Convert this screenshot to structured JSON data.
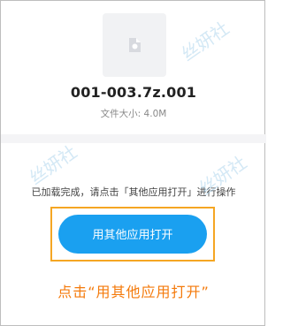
{
  "file": {
    "icon": "file-generic-icon",
    "name": "001-003.7z.001",
    "size_text": "文件大小: 4.0M"
  },
  "status": {
    "text": "已加载完成，请点击「其他应用打开」进行操作"
  },
  "open_button": {
    "label": "用其他应用打开"
  },
  "instruction": {
    "text": "点击“用其他应用打开”"
  },
  "watermark": {
    "text": "丝妍社"
  },
  "colors": {
    "button": "#1aa0f0",
    "highlight": "#f5a623",
    "instruction": "#f47a0b"
  }
}
